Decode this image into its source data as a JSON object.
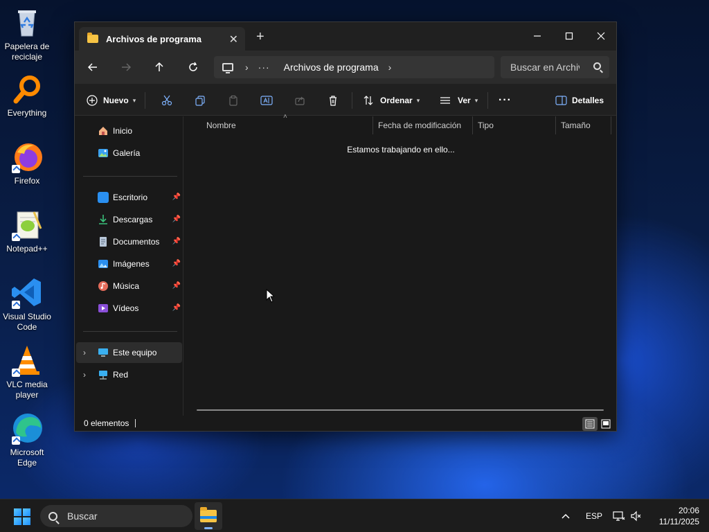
{
  "desktop": {
    "icons": [
      {
        "label_line1": "Papelera de",
        "label_line2": "reciclaje",
        "icon": "recycle-bin-icon"
      },
      {
        "label_line1": "Everything",
        "label_line2": "",
        "icon": "everything-search-icon"
      },
      {
        "label_line1": "Firefox",
        "label_line2": "",
        "icon": "firefox-icon"
      },
      {
        "label_line1": "Notepad++",
        "label_line2": "",
        "icon": "notepad-plus-plus-icon"
      },
      {
        "label_line1": "Visual Studio",
        "label_line2": "Code",
        "icon": "vscode-icon"
      },
      {
        "label_line1": "VLC media",
        "label_line2": "player",
        "icon": "vlc-icon"
      },
      {
        "label_line1": "Microsoft",
        "label_line2": "Edge",
        "icon": "edge-icon"
      }
    ]
  },
  "window": {
    "tab_title": "Archivos de programa",
    "new_tab": "+",
    "address": {
      "ellipsis": "···",
      "crumb": "Archivos de programa"
    },
    "search_placeholder": "Buscar en Archivos de programa",
    "toolbar": {
      "new_label": "Nuevo",
      "sort_label": "Ordenar",
      "view_label": "Ver",
      "more_label": "···",
      "details_label": "Detalles"
    },
    "sidebar": {
      "top": [
        {
          "label": "Inicio",
          "icon": "home-icon"
        },
        {
          "label": "Galería",
          "icon": "gallery-icon"
        }
      ],
      "pinned": [
        {
          "label": "Escritorio",
          "icon": "desktop-folder-icon"
        },
        {
          "label": "Descargas",
          "icon": "downloads-icon"
        },
        {
          "label": "Documentos",
          "icon": "documents-icon"
        },
        {
          "label": "Imágenes",
          "icon": "pictures-icon"
        },
        {
          "label": "Música",
          "icon": "music-icon"
        },
        {
          "label": "Vídeos",
          "icon": "videos-icon"
        }
      ],
      "bottom": [
        {
          "label": "Este equipo",
          "icon": "this-pc-icon"
        },
        {
          "label": "Red",
          "icon": "network-icon"
        }
      ]
    },
    "columns": [
      "Nombre",
      "Fecha de modificación",
      "Tipo",
      "Tamaño"
    ],
    "empty_message": "Estamos trabajando en ello...",
    "status": "0 elementos"
  },
  "taskbar": {
    "search_label": "Buscar",
    "language": "ESP",
    "time": "20:06",
    "date": "11/11/2025"
  },
  "colors": {
    "accent": "#7fb3ff",
    "folder": "#f6c344",
    "window_bg": "#191919"
  }
}
